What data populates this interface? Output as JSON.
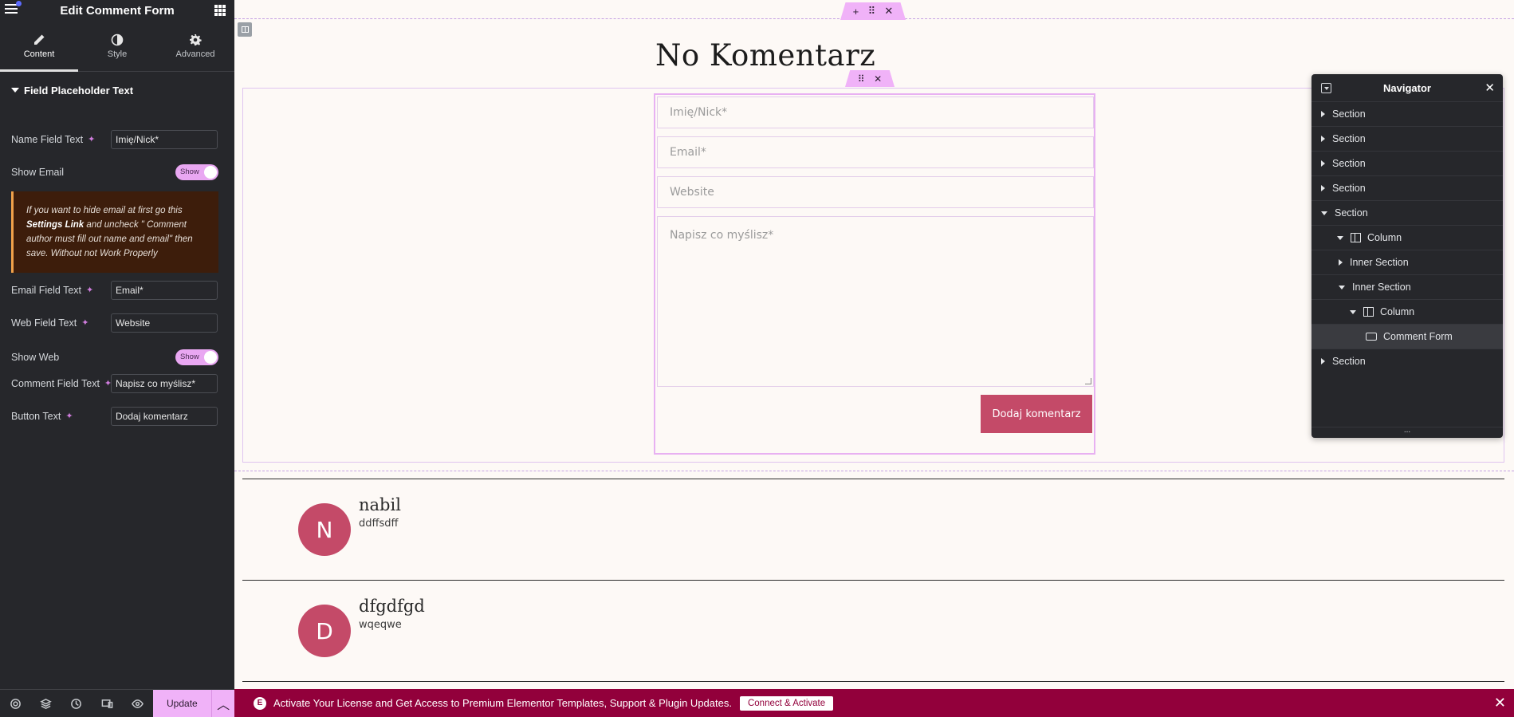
{
  "panel": {
    "title": "Edit Comment Form",
    "tabs": [
      {
        "label": "Content",
        "icon": "pencil-icon"
      },
      {
        "label": "Style",
        "icon": "half-circle-icon"
      },
      {
        "label": "Advanced",
        "icon": "gear-icon"
      }
    ],
    "section_title": "Field Placeholder Text",
    "controls": {
      "name_label": "Name Field Text",
      "name_value": "Imię/Nick*",
      "show_email_label": "Show Email",
      "show_email_toggle": "Show",
      "email_label": "Email Field Text",
      "email_value": "Email*",
      "web_label": "Web Field Text",
      "web_value": "Website",
      "show_web_label": "Show Web",
      "show_web_toggle": "Show",
      "comment_label": "Comment Field Text",
      "comment_value": "Napisz co myślisz*",
      "button_label": "Button Text",
      "button_value": "Dodaj komentarz"
    },
    "notice": {
      "part1": "If you want to hide email at first go this ",
      "link": "Settings Link",
      "part2": " and uncheck \" Comment author must fill out name and email\" then save. Without not Work Properly"
    },
    "footer": {
      "update_label": "Update"
    }
  },
  "canvas": {
    "title": "No Komentarz",
    "form": {
      "name_placeholder": "Imię/Nick*",
      "email_placeholder": "Email*",
      "website_placeholder": "Website",
      "comment_placeholder": "Napisz co myślisz*",
      "submit_label": "Dodaj komentarz"
    },
    "comments": [
      {
        "initial": "N",
        "name": "nabil",
        "text": "ddffsdff"
      },
      {
        "initial": "D",
        "name": "dfgdfgd",
        "text": "wqeqwe"
      }
    ]
  },
  "navigator": {
    "title": "Navigator",
    "items": [
      {
        "label": "Section",
        "level": 0,
        "expanded": false
      },
      {
        "label": "Section",
        "level": 0,
        "expanded": false
      },
      {
        "label": "Section",
        "level": 0,
        "expanded": false
      },
      {
        "label": "Section",
        "level": 0,
        "expanded": false
      },
      {
        "label": "Section",
        "level": 0,
        "expanded": true
      },
      {
        "label": "Column",
        "level": 1,
        "expanded": true
      },
      {
        "label": "Inner Section",
        "level": 2,
        "expanded": false
      },
      {
        "label": "Inner Section",
        "level": 2,
        "expanded": true
      },
      {
        "label": "Column",
        "level": 3,
        "expanded": true
      },
      {
        "label": "Comment Form",
        "level": 4,
        "active": true
      },
      {
        "label": "Section",
        "level": 0,
        "expanded": false
      }
    ]
  },
  "banner": {
    "message": "Activate Your License and Get Access to Premium Elementor Templates, Support & Plugin Updates.",
    "button_label": "Connect & Activate"
  },
  "colors": {
    "accent": "#f0b2f8",
    "brand": "#92003b",
    "button": "#c44a68",
    "panel_bg": "#26272b"
  }
}
